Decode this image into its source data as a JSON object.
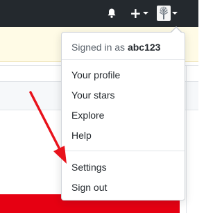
{
  "colors": {
    "header_bg": "#24292e",
    "flash_bg": "#fffbe6",
    "accent_red": "#e60012",
    "annotation_arrow": "#e8121b"
  },
  "header": {
    "notifications_icon": "bell-icon",
    "create_icon": "plus-icon",
    "create_glyph": "+",
    "avatar_icon": "tree-avatar-icon"
  },
  "dropdown": {
    "signed_in_prefix": "Signed in as",
    "username": "abc123",
    "items": [
      {
        "label": "Your profile"
      },
      {
        "label": "Your stars"
      },
      {
        "label": "Explore"
      },
      {
        "label": "Help"
      },
      {
        "label": "Settings"
      },
      {
        "label": "Sign out"
      }
    ]
  },
  "annotation": {
    "arrow_icon": "red-arrow-pointing-to-settings"
  }
}
